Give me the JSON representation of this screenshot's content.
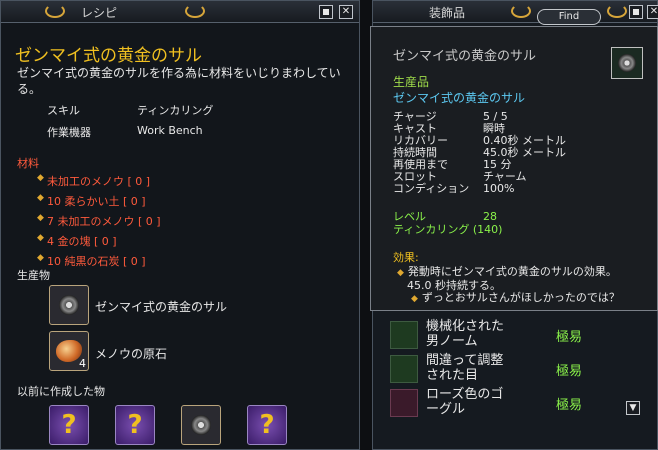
{
  "recipe_window": {
    "title": "レシピ",
    "item_name": "ゼンマイ式の黄金のサル",
    "description": "ゼンマイ式の黄金のサルを作る為に材料をいじりまわしている。",
    "skill_label": "スキル",
    "skill_value": "ティンカリング",
    "equipment_label": "作業機器",
    "equipment_value": "Work Bench",
    "materials_header": "材料",
    "materials": [
      "未加工のメノウ [ 0 ]",
      "10 柔らかい土 [ 0 ]",
      "7 未加工のメノウ [ 0 ]",
      "4 金の塊 [ 0 ]",
      "10 純黒の石炭 [ 0 ]"
    ],
    "products_header": "生産物",
    "products": [
      {
        "name": "ゼンマイ式の黄金のサル",
        "icon": "gear-monkey-icon",
        "qty": ""
      },
      {
        "name": "メノウの原石",
        "icon": "agate-ore-icon",
        "qty": "4"
      }
    ],
    "previous_header": "以前に作成した物",
    "previous_items": [
      "?",
      "?",
      "gear-monkey-icon",
      "?"
    ],
    "buttons": {
      "minimize": "",
      "close": "✕"
    }
  },
  "accessory_window": {
    "title": "装飾品",
    "find_label": "Find",
    "buttons": {
      "minimize": "",
      "close": "✕"
    },
    "list": [
      {
        "name": "機械化された男ノーム",
        "difficulty": "極易",
        "icon": "gnome-icon"
      },
      {
        "name": "間違って調整された目",
        "difficulty": "極易",
        "icon": "eye-icon"
      },
      {
        "name": "ローズ色のゴーグル",
        "difficulty": "極易",
        "icon": "goggles-icon"
      }
    ],
    "scroll_down": "▼"
  },
  "tooltip": {
    "title": "ゼンマイ式の黄金のサル",
    "type": "生産品",
    "subtitle": "ゼンマイ式の黄金のサル",
    "stats": [
      {
        "k": "チャージ",
        "v": "5 / 5"
      },
      {
        "k": "キャスト",
        "v": "瞬時"
      },
      {
        "k": "リカバリー",
        "v": "0.40秒 メートル"
      },
      {
        "k": "持続時間",
        "v": "45.0秒 メートル"
      },
      {
        "k": "再使用まで",
        "v": "15 分"
      },
      {
        "k": "スロット",
        "v": "チャーム"
      },
      {
        "k": "コンディション",
        "v": "100%"
      }
    ],
    "level_label": "レベル",
    "level_value": "28",
    "req": "ティンカリング (140)",
    "effect_header": "効果:",
    "effect_line1": "発動時にゼンマイ式の黄金のサルの効果。",
    "effect_line2": "45.0 秒持続する。",
    "effect_line3": "ずっとおサルさんがほしかったのでは？"
  }
}
